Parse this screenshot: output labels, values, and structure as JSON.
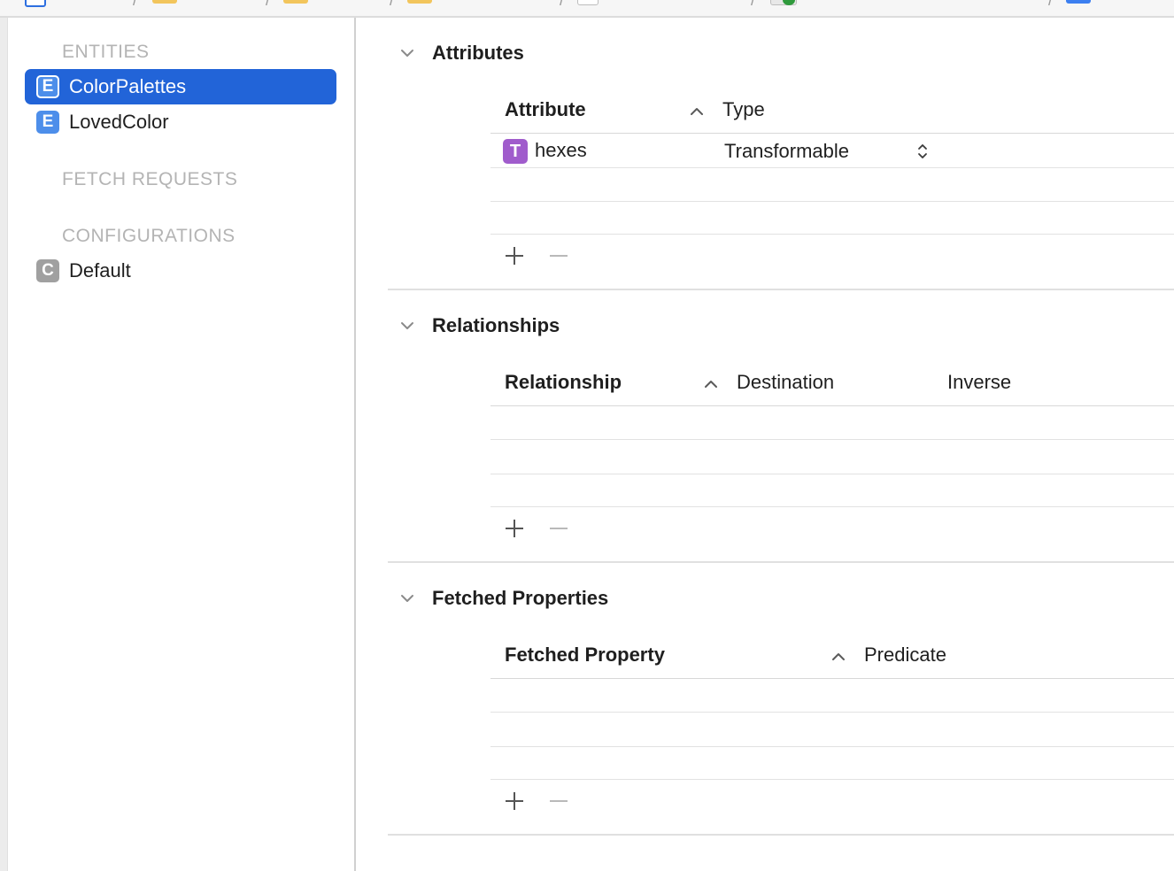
{
  "sidebar": {
    "headings": {
      "entities": "ENTITIES",
      "fetch_requests": "FETCH REQUESTS",
      "configurations": "CONFIGURATIONS"
    },
    "entities": [
      {
        "badge": "E",
        "label": "ColorPalettes",
        "selected": true
      },
      {
        "badge": "E",
        "label": "LovedColor",
        "selected": false
      }
    ],
    "configurations": [
      {
        "badge": "C",
        "label": "Default"
      }
    ]
  },
  "attributes": {
    "title": "Attributes",
    "columns": {
      "name": "Attribute",
      "type": "Type"
    },
    "rows": [
      {
        "badge": "T",
        "name": "hexes",
        "type": "Transformable"
      }
    ]
  },
  "relationships": {
    "title": "Relationships",
    "columns": {
      "name": "Relationship",
      "destination": "Destination",
      "inverse": "Inverse"
    },
    "rows": []
  },
  "fetched_properties": {
    "title": "Fetched Properties",
    "columns": {
      "name": "Fetched Property",
      "predicate": "Predicate"
    },
    "rows": []
  },
  "colors": {
    "selection": "#2264d8",
    "entity_badge": "#4d8eea",
    "attribute_badge": "#a05ccc",
    "config_badge": "#a0a0a0"
  },
  "icons": [
    "folder-icon",
    "file-icon",
    "chevron-down-icon",
    "sort-ascending-icon",
    "plus-icon",
    "minus-icon",
    "stepper-icon"
  ]
}
